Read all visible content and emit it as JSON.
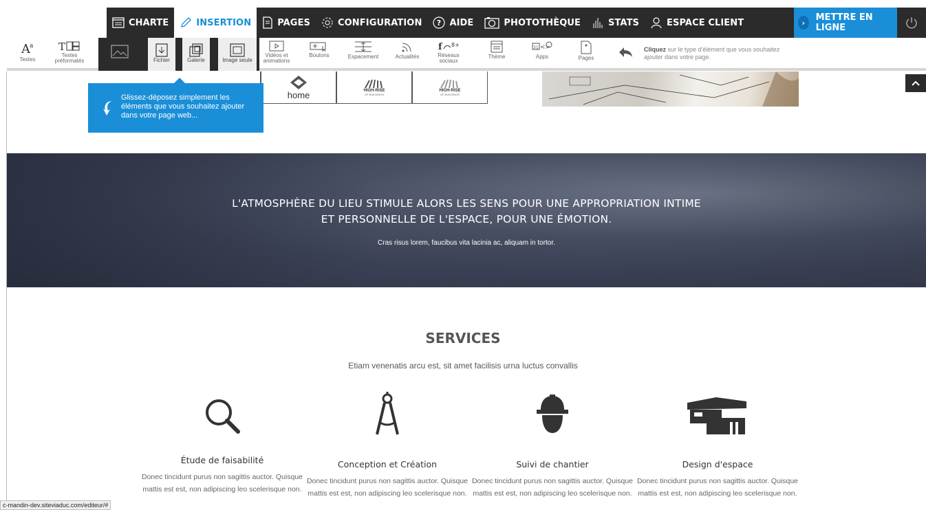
{
  "nav": {
    "items": [
      {
        "label": "CHARTE",
        "icon": "chart-icon"
      },
      {
        "label": "INSERTION",
        "icon": "pencil-icon"
      },
      {
        "label": "PAGES",
        "icon": "pages-icon"
      },
      {
        "label": "CONFIGURATION",
        "icon": "gear-icon"
      },
      {
        "label": "AIDE",
        "icon": "help-icon"
      },
      {
        "label": "PHOTOTHÈQUE",
        "icon": "camera-icon"
      },
      {
        "label": "STATS",
        "icon": "stats-icon"
      },
      {
        "label": "ESPACE CLIENT",
        "icon": "user-icon"
      }
    ],
    "publish": "METTRE EN LIGNE",
    "active": "INSERTION",
    "accent": "#1a8fd8"
  },
  "toolbar": {
    "textes": "Textes",
    "textes_pre_1": "Textes",
    "textes_pre_2": "préformatés",
    "fichier": "Fichier",
    "galerie": "Galerie",
    "image_seule": "Image seule",
    "videos_1": "Vidéos et",
    "videos_2": "animations",
    "boutons": "Boutons",
    "espacement": "Espacement",
    "actualites": "Actualités",
    "reseaux_1": "Réseaux",
    "reseaux_2": "sociaux",
    "theme": "Thème",
    "apps": "Apps",
    "pages": "Pages",
    "hint_bold": "Cliquez",
    "hint_rest": " sur le type d'élément que vous souhaitez ajouter dans votre page."
  },
  "logos": {
    "home": "home",
    "highrise": "HIGH-RISE",
    "highrise_sub": "OF BUILDINGS"
  },
  "tooltip": {
    "text": "Glissez-déposez simplement les éléments que vous souhaitez ajouter dans votre page web..."
  },
  "banner": {
    "line1": "L'ATMOSPHÈRE DU LIEU STIMULE ALORS LES SENS POUR UNE APPROPRIATION INTIME",
    "line2": "ET PERSONNELLE DE L'ESPACE, POUR UNE ÉMOTION.",
    "sub": "Cras risus lorem, faucibus vita lacinia ac, aliquam in tortor."
  },
  "services": {
    "title": "SERVICES",
    "subtitle": "Etiam venenatis arcu est, sit amet facilisis urna luctus convallis",
    "cards": [
      {
        "title": "Étude de faisabilité",
        "text": "Donec tincidunt purus non sagittis auctor. Quisque mattis est est, non adipiscing leo scelerisque non.",
        "icon": "magnifier-icon"
      },
      {
        "title": "Conception et Création",
        "text": "Donec tincidunt purus non sagittis auctor. Quisque mattis est est, non adipiscing leo scelerisque non.",
        "icon": "compass-icon"
      },
      {
        "title": "Suivi de chantier",
        "text": "Donec tincidunt purus non sagittis auctor. Quisque mattis est est, non adipiscing leo scelerisque non.",
        "icon": "worker-helmet-icon"
      },
      {
        "title": "Design d'espace",
        "text": "Donec tincidunt purus non sagittis auctor. Quisque mattis est est, non adipiscing leo scelerisque non.",
        "icon": "building-icon"
      }
    ]
  },
  "status_url": "c-mandin-dev.siteviaduc.com/editeur/#"
}
